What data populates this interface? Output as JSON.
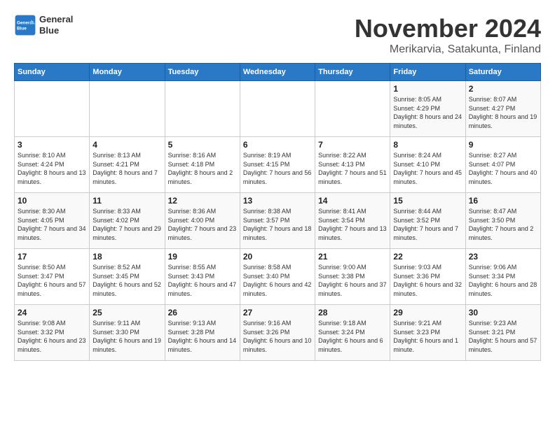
{
  "header": {
    "logo_line1": "General",
    "logo_line2": "Blue",
    "month": "November 2024",
    "location": "Merikarvia, Satakunta, Finland"
  },
  "weekdays": [
    "Sunday",
    "Monday",
    "Tuesday",
    "Wednesday",
    "Thursday",
    "Friday",
    "Saturday"
  ],
  "weeks": [
    [
      {
        "day": "",
        "info": ""
      },
      {
        "day": "",
        "info": ""
      },
      {
        "day": "",
        "info": ""
      },
      {
        "day": "",
        "info": ""
      },
      {
        "day": "",
        "info": ""
      },
      {
        "day": "1",
        "info": "Sunrise: 8:05 AM\nSunset: 4:29 PM\nDaylight: 8 hours and 24 minutes."
      },
      {
        "day": "2",
        "info": "Sunrise: 8:07 AM\nSunset: 4:27 PM\nDaylight: 8 hours and 19 minutes."
      }
    ],
    [
      {
        "day": "3",
        "info": "Sunrise: 8:10 AM\nSunset: 4:24 PM\nDaylight: 8 hours and 13 minutes."
      },
      {
        "day": "4",
        "info": "Sunrise: 8:13 AM\nSunset: 4:21 PM\nDaylight: 8 hours and 7 minutes."
      },
      {
        "day": "5",
        "info": "Sunrise: 8:16 AM\nSunset: 4:18 PM\nDaylight: 8 hours and 2 minutes."
      },
      {
        "day": "6",
        "info": "Sunrise: 8:19 AM\nSunset: 4:15 PM\nDaylight: 7 hours and 56 minutes."
      },
      {
        "day": "7",
        "info": "Sunrise: 8:22 AM\nSunset: 4:13 PM\nDaylight: 7 hours and 51 minutes."
      },
      {
        "day": "8",
        "info": "Sunrise: 8:24 AM\nSunset: 4:10 PM\nDaylight: 7 hours and 45 minutes."
      },
      {
        "day": "9",
        "info": "Sunrise: 8:27 AM\nSunset: 4:07 PM\nDaylight: 7 hours and 40 minutes."
      }
    ],
    [
      {
        "day": "10",
        "info": "Sunrise: 8:30 AM\nSunset: 4:05 PM\nDaylight: 7 hours and 34 minutes."
      },
      {
        "day": "11",
        "info": "Sunrise: 8:33 AM\nSunset: 4:02 PM\nDaylight: 7 hours and 29 minutes."
      },
      {
        "day": "12",
        "info": "Sunrise: 8:36 AM\nSunset: 4:00 PM\nDaylight: 7 hours and 23 minutes."
      },
      {
        "day": "13",
        "info": "Sunrise: 8:38 AM\nSunset: 3:57 PM\nDaylight: 7 hours and 18 minutes."
      },
      {
        "day": "14",
        "info": "Sunrise: 8:41 AM\nSunset: 3:54 PM\nDaylight: 7 hours and 13 minutes."
      },
      {
        "day": "15",
        "info": "Sunrise: 8:44 AM\nSunset: 3:52 PM\nDaylight: 7 hours and 7 minutes."
      },
      {
        "day": "16",
        "info": "Sunrise: 8:47 AM\nSunset: 3:50 PM\nDaylight: 7 hours and 2 minutes."
      }
    ],
    [
      {
        "day": "17",
        "info": "Sunrise: 8:50 AM\nSunset: 3:47 PM\nDaylight: 6 hours and 57 minutes."
      },
      {
        "day": "18",
        "info": "Sunrise: 8:52 AM\nSunset: 3:45 PM\nDaylight: 6 hours and 52 minutes."
      },
      {
        "day": "19",
        "info": "Sunrise: 8:55 AM\nSunset: 3:43 PM\nDaylight: 6 hours and 47 minutes."
      },
      {
        "day": "20",
        "info": "Sunrise: 8:58 AM\nSunset: 3:40 PM\nDaylight: 6 hours and 42 minutes."
      },
      {
        "day": "21",
        "info": "Sunrise: 9:00 AM\nSunset: 3:38 PM\nDaylight: 6 hours and 37 minutes."
      },
      {
        "day": "22",
        "info": "Sunrise: 9:03 AM\nSunset: 3:36 PM\nDaylight: 6 hours and 32 minutes."
      },
      {
        "day": "23",
        "info": "Sunrise: 9:06 AM\nSunset: 3:34 PM\nDaylight: 6 hours and 28 minutes."
      }
    ],
    [
      {
        "day": "24",
        "info": "Sunrise: 9:08 AM\nSunset: 3:32 PM\nDaylight: 6 hours and 23 minutes."
      },
      {
        "day": "25",
        "info": "Sunrise: 9:11 AM\nSunset: 3:30 PM\nDaylight: 6 hours and 19 minutes."
      },
      {
        "day": "26",
        "info": "Sunrise: 9:13 AM\nSunset: 3:28 PM\nDaylight: 6 hours and 14 minutes."
      },
      {
        "day": "27",
        "info": "Sunrise: 9:16 AM\nSunset: 3:26 PM\nDaylight: 6 hours and 10 minutes."
      },
      {
        "day": "28",
        "info": "Sunrise: 9:18 AM\nSunset: 3:24 PM\nDaylight: 6 hours and 6 minutes."
      },
      {
        "day": "29",
        "info": "Sunrise: 9:21 AM\nSunset: 3:23 PM\nDaylight: 6 hours and 1 minute."
      },
      {
        "day": "30",
        "info": "Sunrise: 9:23 AM\nSunset: 3:21 PM\nDaylight: 5 hours and 57 minutes."
      }
    ]
  ]
}
